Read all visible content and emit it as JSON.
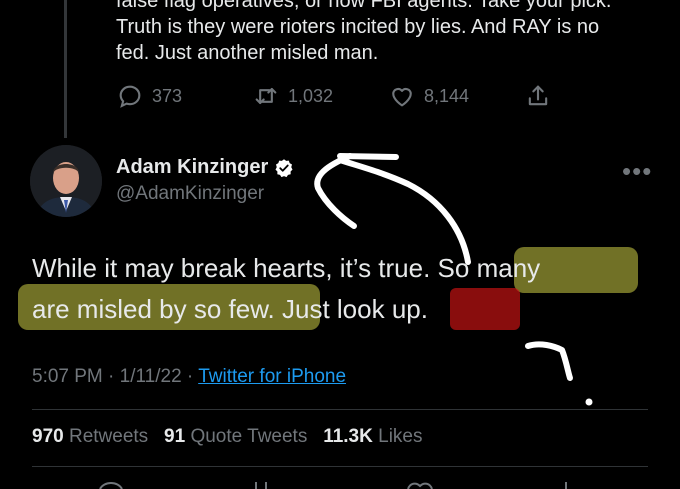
{
  "previous_tweet": {
    "lines": [
      "false flag operatives, or now FBI agents.  Take your pick.",
      "Truth is they were rioters incited by lies.  And RAY is no",
      "fed.  Just another misled man."
    ],
    "replies": "373",
    "retweets": "1,032",
    "likes": "8,144"
  },
  "tweet": {
    "author_name": "Adam Kinzinger",
    "author_handle": "@AdamKinzinger",
    "text_lines": [
      "While it may break hearts, it’s true.  So many",
      "are misled by so few.  Just look up."
    ],
    "time": "5:07 PM",
    "separator": " · ",
    "date": "1/11/22",
    "source": "Twitter for iPhone"
  },
  "stats": {
    "retweets_count": "970",
    "retweets_label": "Retweets",
    "quote_count": "91",
    "quote_label": "Quote Tweets",
    "likes_count": "11.3K",
    "likes_label": "Likes"
  },
  "colors": {
    "background": "#000000",
    "text": "#e7e9ea",
    "secondary": "#71767b",
    "link": "#1d9bf0",
    "verified": "#ffffff",
    "highlight_yellow": "#cdcd46",
    "highlight_red": "#d21414"
  },
  "icons": [
    "reply-icon",
    "retweet-icon",
    "like-icon",
    "share-icon",
    "verified-badge-icon",
    "more-options-icon"
  ]
}
